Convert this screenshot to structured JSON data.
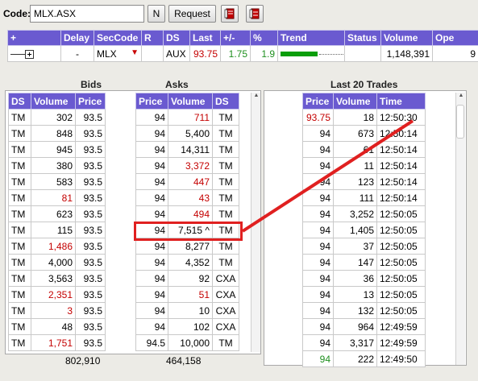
{
  "toolbar": {
    "code_label": "Code:",
    "code_value": "MLX.ASX",
    "n_label": "N",
    "request_label": "Request"
  },
  "top_grid": {
    "headers": [
      "+",
      "Delay",
      "SecCode",
      "R",
      "DS",
      "Last",
      "+/-",
      "%",
      "Trend",
      "Status",
      "Volume",
      "Ope"
    ],
    "row": {
      "delay": "-",
      "seccode": "MLX",
      "ds": "AUX",
      "last": "93.75",
      "change": "1.75",
      "pct": "1.9",
      "status": "",
      "volume": "1,148,391",
      "open": "9"
    }
  },
  "sections": {
    "bids_title": "Bids",
    "asks_title": "Asks",
    "trades_title": "Last 20 Trades"
  },
  "bids": {
    "headers": [
      "DS",
      "Volume",
      "Price"
    ],
    "rows": [
      {
        "ds": "TM",
        "volume": "302",
        "price": "93.5",
        "vol_color": ""
      },
      {
        "ds": "TM",
        "volume": "848",
        "price": "93.5",
        "vol_color": ""
      },
      {
        "ds": "TM",
        "volume": "945",
        "price": "93.5",
        "vol_color": ""
      },
      {
        "ds": "TM",
        "volume": "380",
        "price": "93.5",
        "vol_color": ""
      },
      {
        "ds": "TM",
        "volume": "583",
        "price": "93.5",
        "vol_color": ""
      },
      {
        "ds": "TM",
        "volume": "81",
        "price": "93.5",
        "vol_color": "red"
      },
      {
        "ds": "TM",
        "volume": "623",
        "price": "93.5",
        "vol_color": ""
      },
      {
        "ds": "TM",
        "volume": "115",
        "price": "93.5",
        "vol_color": ""
      },
      {
        "ds": "TM",
        "volume": "1,486",
        "price": "93.5",
        "vol_color": "red"
      },
      {
        "ds": "TM",
        "volume": "4,000",
        "price": "93.5",
        "vol_color": ""
      },
      {
        "ds": "TM",
        "volume": "3,563",
        "price": "93.5",
        "vol_color": ""
      },
      {
        "ds": "TM",
        "volume": "2,351",
        "price": "93.5",
        "vol_color": "red"
      },
      {
        "ds": "TM",
        "volume": "3",
        "price": "93.5",
        "vol_color": "red"
      },
      {
        "ds": "TM",
        "volume": "48",
        "price": "93.5",
        "vol_color": ""
      },
      {
        "ds": "TM",
        "volume": "1,751",
        "price": "93.5",
        "vol_color": "red"
      }
    ],
    "total": "802,910"
  },
  "asks": {
    "headers": [
      "Price",
      "Volume",
      "DS"
    ],
    "rows": [
      {
        "price": "94",
        "volume": "711",
        "ds": "TM",
        "vol_color": "red"
      },
      {
        "price": "94",
        "volume": "5,400",
        "ds": "TM",
        "vol_color": ""
      },
      {
        "price": "94",
        "volume": "14,311",
        "ds": "TM",
        "vol_color": ""
      },
      {
        "price": "94",
        "volume": "3,372",
        "ds": "TM",
        "vol_color": "red"
      },
      {
        "price": "94",
        "volume": "447",
        "ds": "TM",
        "vol_color": "red"
      },
      {
        "price": "94",
        "volume": "43",
        "ds": "TM",
        "vol_color": "red"
      },
      {
        "price": "94",
        "volume": "494",
        "ds": "TM",
        "vol_color": "red"
      },
      {
        "price": "94",
        "volume": "7,515 ^",
        "ds": "TM",
        "vol_color": ""
      },
      {
        "price": "94",
        "volume": "8,277",
        "ds": "TM",
        "vol_color": ""
      },
      {
        "price": "94",
        "volume": "4,352",
        "ds": "TM",
        "vol_color": ""
      },
      {
        "price": "94",
        "volume": "92",
        "ds": "CXA",
        "vol_color": ""
      },
      {
        "price": "94",
        "volume": "51",
        "ds": "CXA",
        "vol_color": "red"
      },
      {
        "price": "94",
        "volume": "10",
        "ds": "CXA",
        "vol_color": ""
      },
      {
        "price": "94",
        "volume": "102",
        "ds": "CXA",
        "vol_color": ""
      },
      {
        "price": "94.5",
        "volume": "10,000",
        "ds": "TM",
        "vol_color": ""
      }
    ],
    "total": "464,158"
  },
  "trades": {
    "headers": [
      "Price",
      "Volume",
      "Time"
    ],
    "rows": [
      {
        "price": "93.75",
        "volume": "18",
        "time": "12:50:30",
        "price_color": "red"
      },
      {
        "price": "94",
        "volume": "673",
        "time": "12:50:14",
        "price_color": ""
      },
      {
        "price": "94",
        "volume": "61",
        "time": "12:50:14",
        "price_color": ""
      },
      {
        "price": "94",
        "volume": "11",
        "time": "12:50:14",
        "price_color": ""
      },
      {
        "price": "94",
        "volume": "123",
        "time": "12:50:14",
        "price_color": ""
      },
      {
        "price": "94",
        "volume": "111",
        "time": "12:50:14",
        "price_color": ""
      },
      {
        "price": "94",
        "volume": "3,252",
        "time": "12:50:05",
        "price_color": ""
      },
      {
        "price": "94",
        "volume": "1,405",
        "time": "12:50:05",
        "price_color": ""
      },
      {
        "price": "94",
        "volume": "37",
        "time": "12:50:05",
        "price_color": ""
      },
      {
        "price": "94",
        "volume": "147",
        "time": "12:50:05",
        "price_color": ""
      },
      {
        "price": "94",
        "volume": "36",
        "time": "12:50:05",
        "price_color": ""
      },
      {
        "price": "94",
        "volume": "13",
        "time": "12:50:05",
        "price_color": ""
      },
      {
        "price": "94",
        "volume": "132",
        "time": "12:50:05",
        "price_color": ""
      },
      {
        "price": "94",
        "volume": "964",
        "time": "12:49:59",
        "price_color": ""
      },
      {
        "price": "94",
        "volume": "3,317",
        "time": "12:49:59",
        "price_color": ""
      },
      {
        "price": "94",
        "volume": "222",
        "time": "12:49:50",
        "price_color": "green"
      }
    ]
  },
  "colors": {
    "header_bg": "#6a5ad0",
    "highlight": "#e02020",
    "down": "#c40000",
    "up": "#1f8f1f"
  },
  "icons": {
    "tree": "tree-expand-icon",
    "flag": "red-flag-icon",
    "trend": "trend-bar-icon",
    "book1": "red-book-icon",
    "book2": "red-book-icon"
  }
}
